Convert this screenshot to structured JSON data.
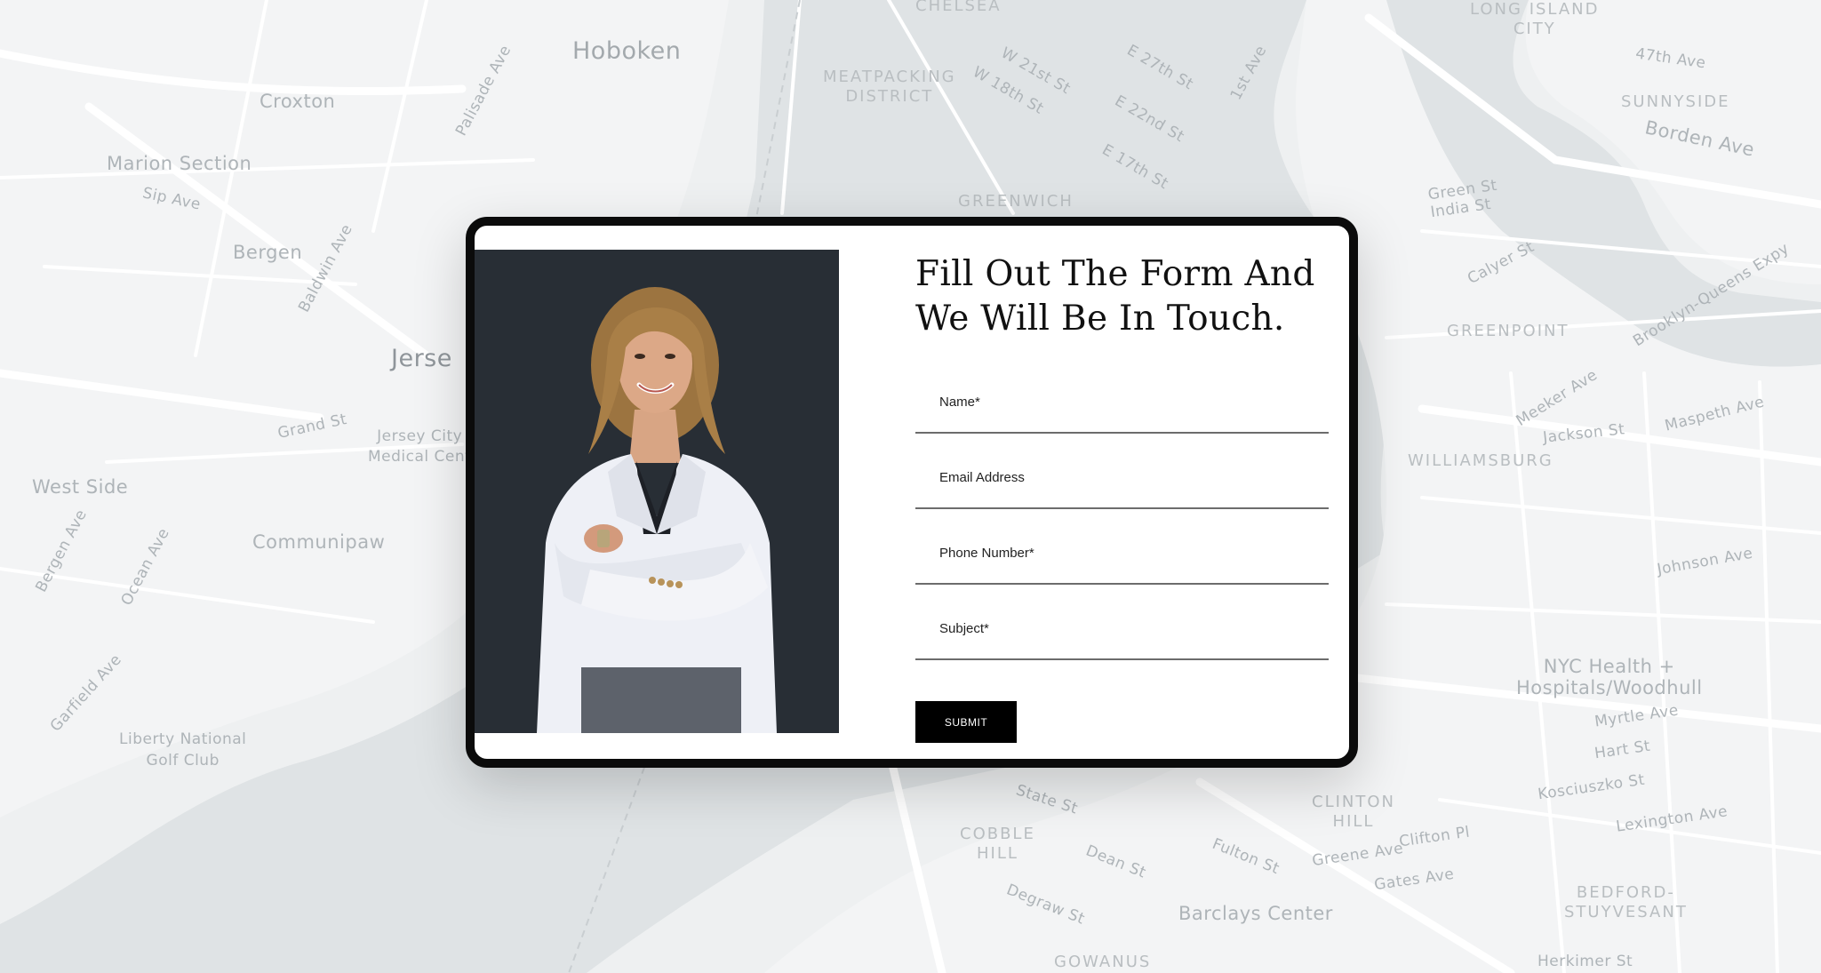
{
  "map": {
    "labels": {
      "hoboken": "Hoboken",
      "croxton": "Croxton",
      "marion_section": "Marion Section",
      "sip_ave": "Sip Ave",
      "bergen": "Bergen",
      "jersey": "Jerse",
      "jersey_city_medical": "Jersey City\nMedical Cent",
      "west_side": "West Side",
      "communipaw": "Communipaw",
      "liberty_national": "Liberty National\nGolf Club",
      "chelsea": "CHELSEA",
      "meatpacking": "MEATPACKING\nDISTRICT",
      "greenwich": "GREENWICH",
      "long_island_city": "LONG ISLAND\nCITY",
      "sunnyside": "SUNNYSIDE",
      "borden_ave": "Borden Ave",
      "greenpoint": "GREENPOINT",
      "williamsburg": "WILLIAMSBURG",
      "brooklyn_queens_expy": "Brooklyn-Queens Expy",
      "nyc_health": "NYC Health +\nHospitals/Woodhull",
      "myrtle_ave": "Myrtle Ave",
      "clinton_hill": "CLINTON\nHILL",
      "cobble_hill": "COBBLE\nHILL",
      "barclays_center": "Barclays Center",
      "bedford_stuyvesant": "BEDFORD-\nSTUYVESANT",
      "gowanus": "GOWANUS",
      "johnson_ave": "Johnson Ave",
      "grand_st": "Grand St",
      "palisade_ave": "Palisade Ave",
      "baldwin_ave": "Baldwin Ave",
      "ocean_ave": "Ocean Ave",
      "bergen_ave": "Bergen Ave",
      "garfield_ave": "Garfield Ave",
      "first_ave": "1st Ave",
      "e27th": "E 27th St",
      "e22nd": "E 22nd St",
      "e17th": "E 17th St",
      "w21st": "W 21st St",
      "w18th": "W 18th St",
      "fulton_st": "Fulton St",
      "state_st": "State St",
      "dean_st": "Dean St",
      "degraw_st": "Degraw St",
      "clifton_pl": "Clifton Pl",
      "greene_ave": "Greene Ave",
      "gates_ave": "Gates Ave",
      "lexington_ave": "Lexington Ave",
      "kosciuszko_st": "Kosciuszko St",
      "hart_st": "Hart St",
      "herkimer_st": "Herkimer St",
      "meeker_ave": "Meeker Ave",
      "jackson_st": "Jackson St",
      "maspeth_ave": "Maspeth Ave",
      "calyer_st": "Calyer St",
      "green_st": "Green St\nIndia St",
      "47th_ave": "47th Ave"
    }
  },
  "modal": {
    "heading": "Fill Out The Form And We Will Be In Touch.",
    "fields": [
      {
        "label": "Name*"
      },
      {
        "label": "Email Address"
      },
      {
        "label": "Phone Number*"
      },
      {
        "label": "Subject*"
      }
    ],
    "submit_label": "SUBMIT"
  }
}
